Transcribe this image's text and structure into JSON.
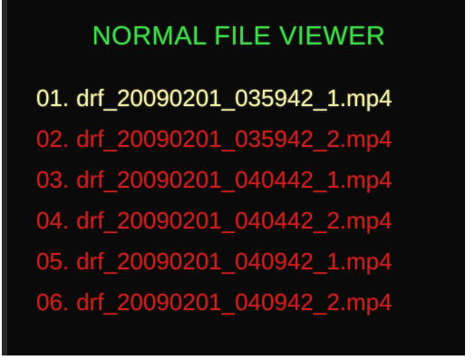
{
  "viewer": {
    "title": "NORMAL FILE VIEWER",
    "colors": {
      "title": "#3fd84a",
      "selected": "#f0eea8",
      "normal": "#c81e1e",
      "background": "#0a0a0a"
    },
    "files": [
      {
        "index": "01.",
        "name": "drf_20090201_035942_1.mp4",
        "selected": true
      },
      {
        "index": "02.",
        "name": "drf_20090201_035942_2.mp4",
        "selected": false
      },
      {
        "index": "03.",
        "name": "drf_20090201_040442_1.mp4",
        "selected": false
      },
      {
        "index": "04.",
        "name": "drf_20090201_040442_2.mp4",
        "selected": false
      },
      {
        "index": "05.",
        "name": "drf_20090201_040942_1.mp4",
        "selected": false
      },
      {
        "index": "06.",
        "name": "drf_20090201_040942_2.mp4",
        "selected": false
      }
    ]
  }
}
